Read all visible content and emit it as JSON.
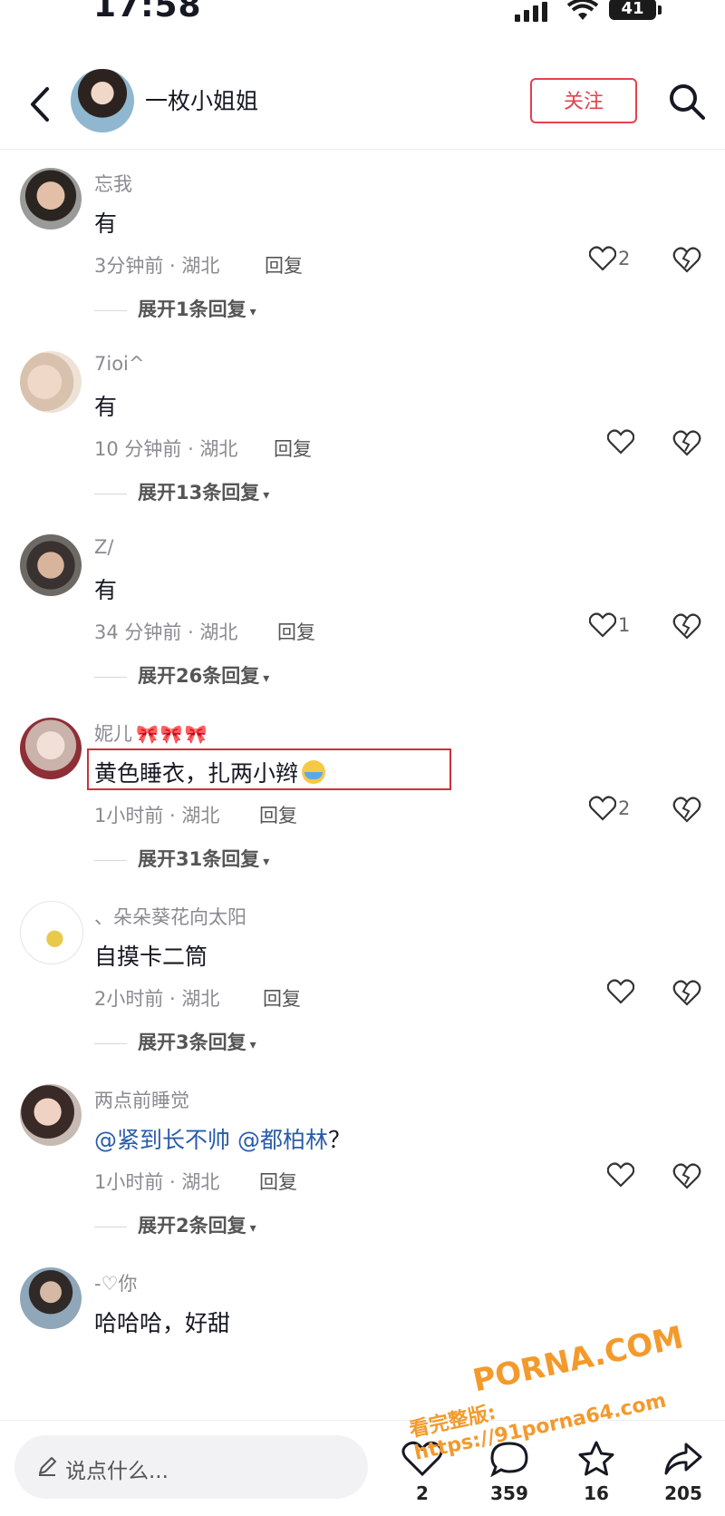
{
  "status_bar": {
    "time": "17:58",
    "battery": "41"
  },
  "header": {
    "username": "一枚小姐姐",
    "follow_label": "关注"
  },
  "comments": [
    {
      "user": "忘我",
      "text": "有",
      "time_location": "3分钟前 · 湖北",
      "reply_label": "回复",
      "likes": "2",
      "expand_label": "展开1条回复"
    },
    {
      "user": "7ioi^",
      "text": "有",
      "time_location": "10 分钟前 · 湖北",
      "reply_label": "回复",
      "likes": "",
      "expand_label": "展开13条回复"
    },
    {
      "user": "Z/",
      "text": "有",
      "time_location": "34 分钟前 · 湖北",
      "reply_label": "回复",
      "likes": "1",
      "expand_label": "展开26条回复"
    },
    {
      "user": "妮儿",
      "text": "黄色睡衣，扎两小辫",
      "time_location": "1小时前 · 湖北",
      "reply_label": "回复",
      "likes": "2",
      "expand_label": "展开31条回复"
    },
    {
      "user": "、朵朵葵花向太阳",
      "text": "自摸卡二筒",
      "time_location": "2小时前 · 湖北",
      "reply_label": "回复",
      "likes": "",
      "expand_label": "展开3条回复"
    },
    {
      "user": "两点前睡觉",
      "mention1": "@紧到长不帅",
      "mention2": "@都柏林",
      "text_tail": "？",
      "time_location": "1小时前 · 湖北",
      "reply_label": "回复",
      "likes": "",
      "expand_label": "展开2条回复"
    },
    {
      "user": "-♡你",
      "text": "哈哈哈，好甜"
    }
  ],
  "bottom_bar": {
    "input_placeholder": "说点什么...",
    "likes_count": "2",
    "comments_count": "359",
    "favorites_count": "16",
    "shares_count": "205"
  },
  "watermark": {
    "line1": "PORNA.COM",
    "line2": "看完整版: https://91porna64.com"
  },
  "colors": {
    "accent": "#e6414f",
    "mention": "#2a5cab",
    "muted": "#8a8b91",
    "highlight_box": "#c9343b"
  }
}
